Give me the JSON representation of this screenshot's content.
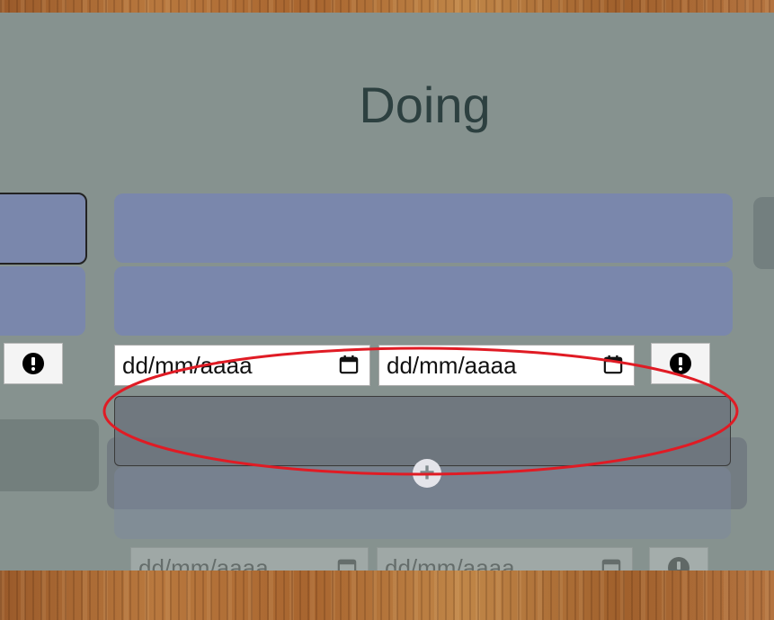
{
  "column": {
    "title": "Doing"
  },
  "task": {
    "start_date_placeholder": "dd/mm/aaaa",
    "end_date_placeholder": "dd/mm/aaaa"
  },
  "ghost_task": {
    "start_date_placeholder": "dd/mm/aaaa",
    "end_date_placeholder": "dd/mm/aaaa"
  },
  "colors": {
    "board": "#86928f",
    "card": "#7a87ac",
    "title": "#2d4040",
    "annotation": "#e01b24"
  },
  "icons": [
    "alert-icon",
    "calendar-icon",
    "plus-icon"
  ]
}
